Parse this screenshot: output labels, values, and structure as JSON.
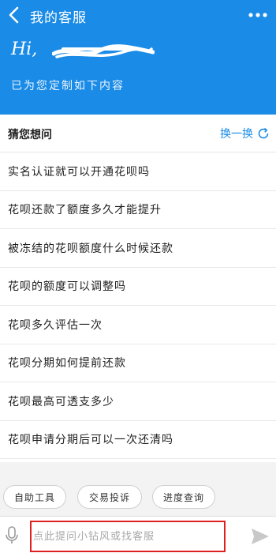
{
  "nav": {
    "title": "我的客服",
    "back_icon": "back-chevron-icon",
    "more_icon": "more-dots-icon"
  },
  "greeting": {
    "hi": "Hi,",
    "subtitle": "已为您定制如下内容"
  },
  "section": {
    "title": "猜您想问",
    "refresh_label": "换一换",
    "refresh_icon": "refresh-icon"
  },
  "questions": [
    "实名认证就可以开通花呗吗",
    "花呗还款了额度多久才能提升",
    "被冻结的花呗额度什么时候还款",
    "花呗的额度可以调整吗",
    "花呗多久评估一次",
    "花呗分期如何提前还款",
    "花呗最高可透支多少",
    "花呗申请分期后可以一次还清吗"
  ],
  "shortcuts": [
    "自助工具",
    "交易投诉",
    "进度查询"
  ],
  "input": {
    "placeholder": "点此提问小钻风或找客服",
    "mic_icon": "mic-icon",
    "send_icon": "send-icon"
  },
  "colors": {
    "brand": "#1a8be6",
    "highlight": "#e02020"
  }
}
